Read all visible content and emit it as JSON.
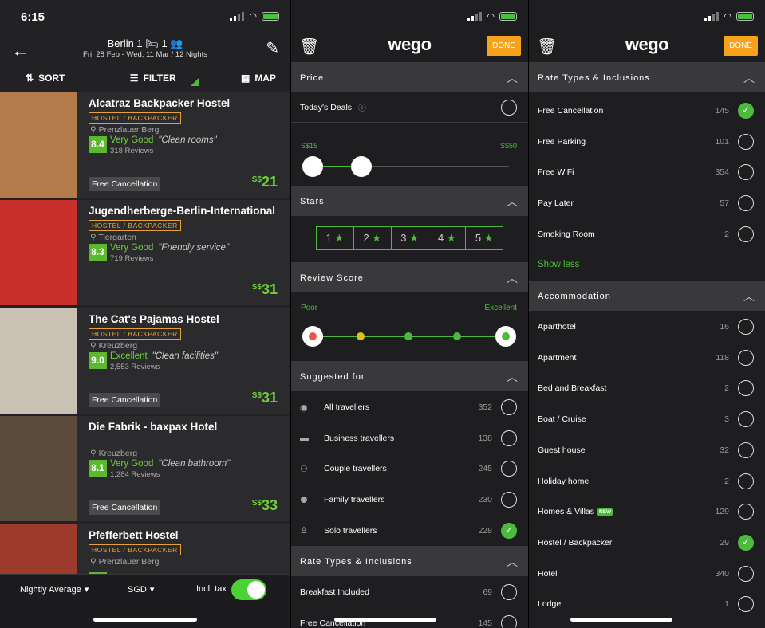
{
  "status": {
    "time": "6:15"
  },
  "results": {
    "header": {
      "city": "Berlin 1 🛏 1 👥",
      "dates": "Fri, 28 Feb - Wed, 11 Mar / 12 Nights"
    },
    "toolbar": {
      "sort": "SORT",
      "filter": "FILTER",
      "map": "MAP"
    },
    "hotels": [
      {
        "name": "Alcatraz Backpacker Hostel",
        "type": "HOSTEL / BACKPACKER",
        "location": "Prenzlauer Berg",
        "score": "8.4",
        "rating": "Very Good",
        "quote": "\"Clean rooms\"",
        "reviews": "318 Reviews",
        "badge": "Free Cancellation",
        "currency": "S$",
        "price": "21",
        "photo_color": "#b37a4a"
      },
      {
        "name": "Jugendherberge-Berlin-International",
        "type": "HOSTEL / BACKPACKER",
        "location": "Tiergarten",
        "score": "8.3",
        "rating": "Very Good",
        "quote": "\"Friendly service\"",
        "reviews": "719 Reviews",
        "badge": "",
        "currency": "S$",
        "price": "31",
        "photo_color": "#c9302c"
      },
      {
        "name": "The Cat's Pajamas Hostel",
        "type": "HOSTEL / BACKPACKER",
        "location": "Kreuzberg",
        "score": "9.0",
        "rating": "Excellent",
        "quote": "\"Clean facilities\"",
        "reviews": "2,553 Reviews",
        "badge": "Free Cancellation",
        "currency": "S$",
        "price": "31",
        "photo_color": "#c8c1b4"
      },
      {
        "name": "Die Fabrik - baxpax Hotel",
        "type": "",
        "location": "Kreuzberg",
        "score": "8.1",
        "rating": "Very Good",
        "quote": "\"Clean bathroom\"",
        "reviews": "1,284 Reviews",
        "badge": "Free Cancellation",
        "currency": "S$",
        "price": "33",
        "photo_color": "#5a4a3a"
      },
      {
        "name": "Pfefferbett Hostel",
        "type": "HOSTEL / BACKPACKER",
        "location": "Prenzlauer Berg",
        "score": "",
        "rating": "",
        "quote": "",
        "reviews": "",
        "badge": "",
        "currency": "",
        "price": "",
        "photo_color": "#9c3b2c"
      }
    ],
    "footer": {
      "nightly": "Nightly Average",
      "currency": "SGD",
      "tax": "Incl. tax"
    }
  },
  "filter1": {
    "logo": "wego",
    "done": "DONE",
    "price": {
      "title": "Price",
      "deals": "Today's Deals",
      "min": "S$15",
      "max": "S$50"
    },
    "stars": {
      "title": "Stars",
      "items": [
        "1",
        "2",
        "3",
        "4",
        "5"
      ]
    },
    "review": {
      "title": "Review Score",
      "low": "Poor",
      "high": "Excellent"
    },
    "suggested": {
      "title": "Suggested for",
      "items": [
        {
          "label": "All travellers",
          "count": "352",
          "on": false
        },
        {
          "label": "Business travellers",
          "count": "138",
          "on": false
        },
        {
          "label": "Couple travellers",
          "count": "245",
          "on": false
        },
        {
          "label": "Family travellers",
          "count": "230",
          "on": false
        },
        {
          "label": "Solo travellers",
          "count": "228",
          "on": true
        }
      ]
    },
    "rates": {
      "title": "Rate Types & Inclusions",
      "items": [
        {
          "label": "Breakfast Included",
          "count": "69"
        },
        {
          "label": "Free Cancellation",
          "count": "145"
        }
      ]
    }
  },
  "filter2": {
    "logo": "wego",
    "done": "DONE",
    "rates": {
      "title": "Rate Types & Inclusions",
      "items": [
        {
          "label": "Free Cancellation",
          "count": "145",
          "on": true
        },
        {
          "label": "Free Parking",
          "count": "101",
          "on": false
        },
        {
          "label": "Free WiFi",
          "count": "354",
          "on": false
        },
        {
          "label": "Pay Later",
          "count": "57",
          "on": false
        },
        {
          "label": "Smoking Room",
          "count": "2",
          "on": false
        }
      ],
      "show_less": "Show less"
    },
    "accommodation": {
      "title": "Accommodation",
      "new_badge": "NEW",
      "items": [
        {
          "label": "Aparthotel",
          "count": "16",
          "on": false
        },
        {
          "label": "Apartment",
          "count": "118",
          "on": false
        },
        {
          "label": "Bed and Breakfast",
          "count": "2",
          "on": false
        },
        {
          "label": "Boat / Cruise",
          "count": "3",
          "on": false
        },
        {
          "label": "Guest house",
          "count": "32",
          "on": false
        },
        {
          "label": "Holiday home",
          "count": "2",
          "on": false
        },
        {
          "label": "Homes & Villas",
          "count": "129",
          "on": false
        },
        {
          "label": "Hostel / Backpacker",
          "count": "29",
          "on": true
        },
        {
          "label": "Hotel",
          "count": "340",
          "on": false
        },
        {
          "label": "Lodge",
          "count": "1",
          "on": false
        }
      ]
    }
  }
}
